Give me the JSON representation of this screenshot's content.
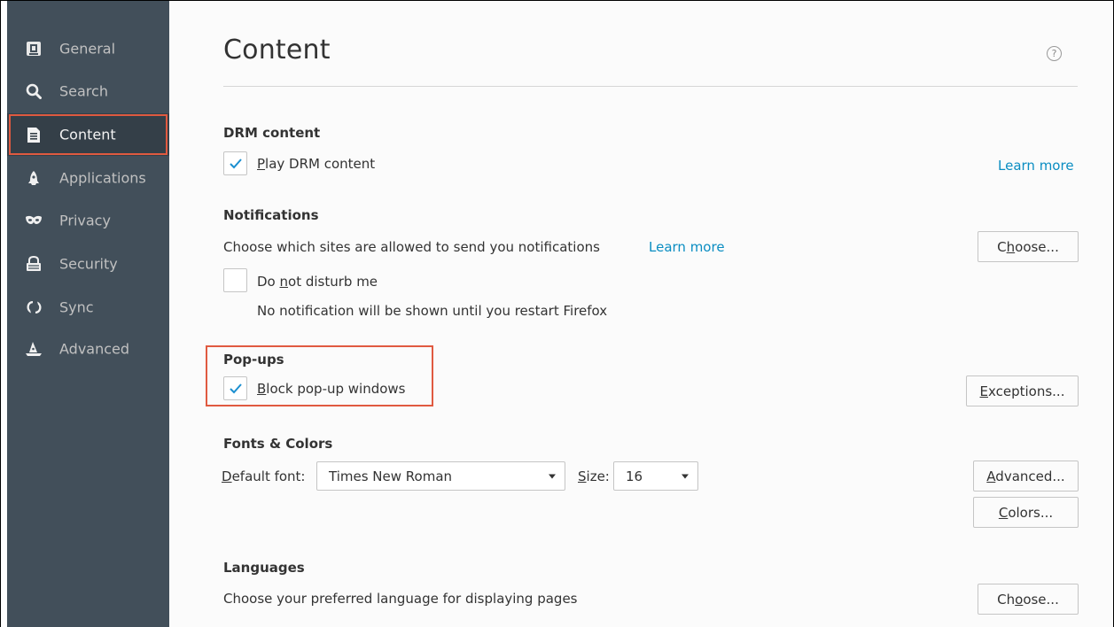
{
  "sidebar": {
    "items": [
      {
        "label": "General",
        "icon": "general-icon"
      },
      {
        "label": "Search",
        "icon": "search-icon"
      },
      {
        "label": "Content",
        "icon": "document-icon",
        "active": true
      },
      {
        "label": "Applications",
        "icon": "rocket-icon"
      },
      {
        "label": "Privacy",
        "icon": "mask-icon"
      },
      {
        "label": "Security",
        "icon": "security-icon"
      },
      {
        "label": "Sync",
        "icon": "sync-icon"
      },
      {
        "label": "Advanced",
        "icon": "wizard-hat-icon"
      }
    ]
  },
  "page": {
    "title": "Content",
    "help_symbol": "?"
  },
  "drm": {
    "heading": "DRM content",
    "checkbox_label": "Play DRM content",
    "checked": true,
    "learn_more": "Learn more"
  },
  "notifications": {
    "heading": "Notifications",
    "description": "Choose which sites are allowed to send you notifications",
    "learn_more": "Learn more",
    "choose_button": "Choose...",
    "dnd_label": "Do not disturb me",
    "dnd_checked": false,
    "dnd_note": "No notification will be shown until you restart Firefox"
  },
  "popups": {
    "heading": "Pop-ups",
    "checkbox_label": "Block pop-up windows",
    "checked": true,
    "exceptions_button": "Exceptions..."
  },
  "fonts": {
    "heading": "Fonts & Colors",
    "default_font_label": "Default font:",
    "default_font_value": "Times New Roman",
    "size_label": "Size:",
    "size_value": "16",
    "advanced_button": "Advanced...",
    "colors_button": "Colors..."
  },
  "languages": {
    "heading": "Languages",
    "description": "Choose your preferred language for displaying pages",
    "choose_button": "Choose..."
  },
  "colors": {
    "sidebar_bg": "#424f5a",
    "active_bg": "#343f48",
    "highlight": "#e05a40",
    "link": "#0a8dc2",
    "check": "#1b8fd0"
  }
}
